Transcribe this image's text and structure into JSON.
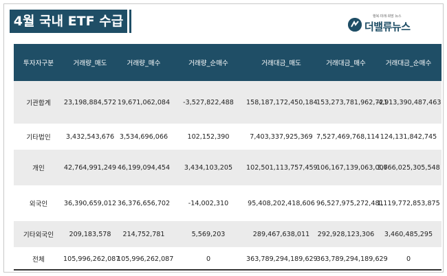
{
  "title": "4월 국내 ETF 수급",
  "logo": {
    "small_text": "행복·미래·희망 뉴스",
    "name": "더밸류뉴스",
    "icon": "value-news-logo-icon"
  },
  "colors": {
    "header_bg": "#1f4e66",
    "shade_row": "#ebebeb"
  },
  "table": {
    "headers": [
      "투자자구분",
      "거래량_매도",
      "거래량_매수",
      "거래량_순매수",
      "거래대금_매도",
      "거래대금_매수",
      "거래대금_순매수"
    ],
    "rows": [
      [
        "기관합계",
        "23,198,884,572",
        "19,671,062,084",
        "-3,527,822,488",
        "158,187,172,450,184",
        "153,273,781,962,721",
        "-4,913,390,487,463"
      ],
      [
        "기타법인",
        "3,432,543,676",
        "3,534,696,066",
        "102,152,390",
        "7,403,337,925,369",
        "7,527,469,768,114",
        "124,131,842,745"
      ],
      [
        "개인",
        "42,764,991,249",
        "46,199,094,454",
        "3,434,103,205",
        "102,501,113,757,459",
        "106,167,139,063,007",
        "3,666,025,305,548"
      ],
      [
        "외국인",
        "36,390,659,012",
        "36,376,656,702",
        "-14,002,310",
        "95,408,202,418,606",
        "96,527,975,272,481",
        "1,119,772,853,875"
      ],
      [
        "기타외국인",
        "209,183,578",
        "214,752,781",
        "5,569,203",
        "289,467,638,011",
        "292,928,123,306",
        "3,460,485,295"
      ],
      [
        "전체",
        "105,996,262,087",
        "105,996,262,087",
        "0",
        "363,789,294,189,629",
        "363,789,294,189,629",
        "0"
      ]
    ]
  }
}
